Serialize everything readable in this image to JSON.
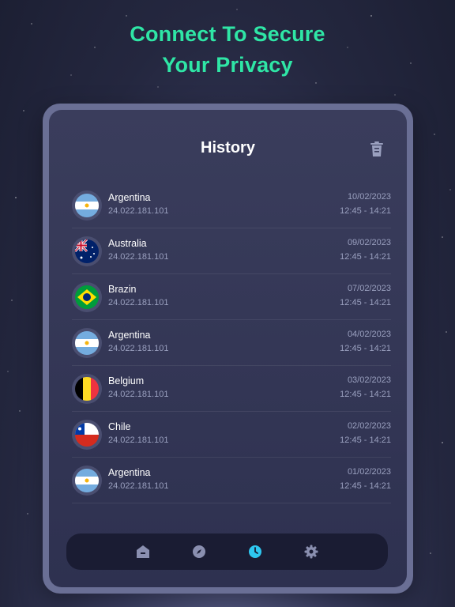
{
  "headline": {
    "line1": "Connect To Secure",
    "line2": "Your Privacy"
  },
  "screen": {
    "title": "History",
    "clear_icon": "trash-icon"
  },
  "history": [
    {
      "country": "Argentina",
      "flag": "argentina",
      "ip": "24.022.181.101",
      "date": "10/02/2023",
      "time": "12:45 - 14:21"
    },
    {
      "country": "Australia",
      "flag": "australia",
      "ip": "24.022.181.101",
      "date": "09/02/2023",
      "time": "12:45 - 14:21"
    },
    {
      "country": "Brazin",
      "flag": "brazil",
      "ip": "24.022.181.101",
      "date": "07/02/2023",
      "time": "12:45 - 14:21"
    },
    {
      "country": "Argentina",
      "flag": "argentina",
      "ip": "24.022.181.101",
      "date": "04/02/2023",
      "time": "12:45 - 14:21"
    },
    {
      "country": "Belgium",
      "flag": "belgium",
      "ip": "24.022.181.101",
      "date": "03/02/2023",
      "time": "12:45 - 14:21"
    },
    {
      "country": "Chile",
      "flag": "chile",
      "ip": "24.022.181.101",
      "date": "02/02/2023",
      "time": "12:45 - 14:21"
    },
    {
      "country": "Argentina",
      "flag": "argentina",
      "ip": "24.022.181.101",
      "date": "01/02/2023",
      "time": "12:45 - 14:21"
    }
  ],
  "nav": {
    "items": [
      "home-icon",
      "compass-icon",
      "clock-icon",
      "gear-icon"
    ],
    "active": "clock-icon"
  },
  "colors": {
    "accent": "#2fe6a6",
    "active_nav": "#2ec7f0",
    "inactive_nav": "#8a8fb0"
  }
}
